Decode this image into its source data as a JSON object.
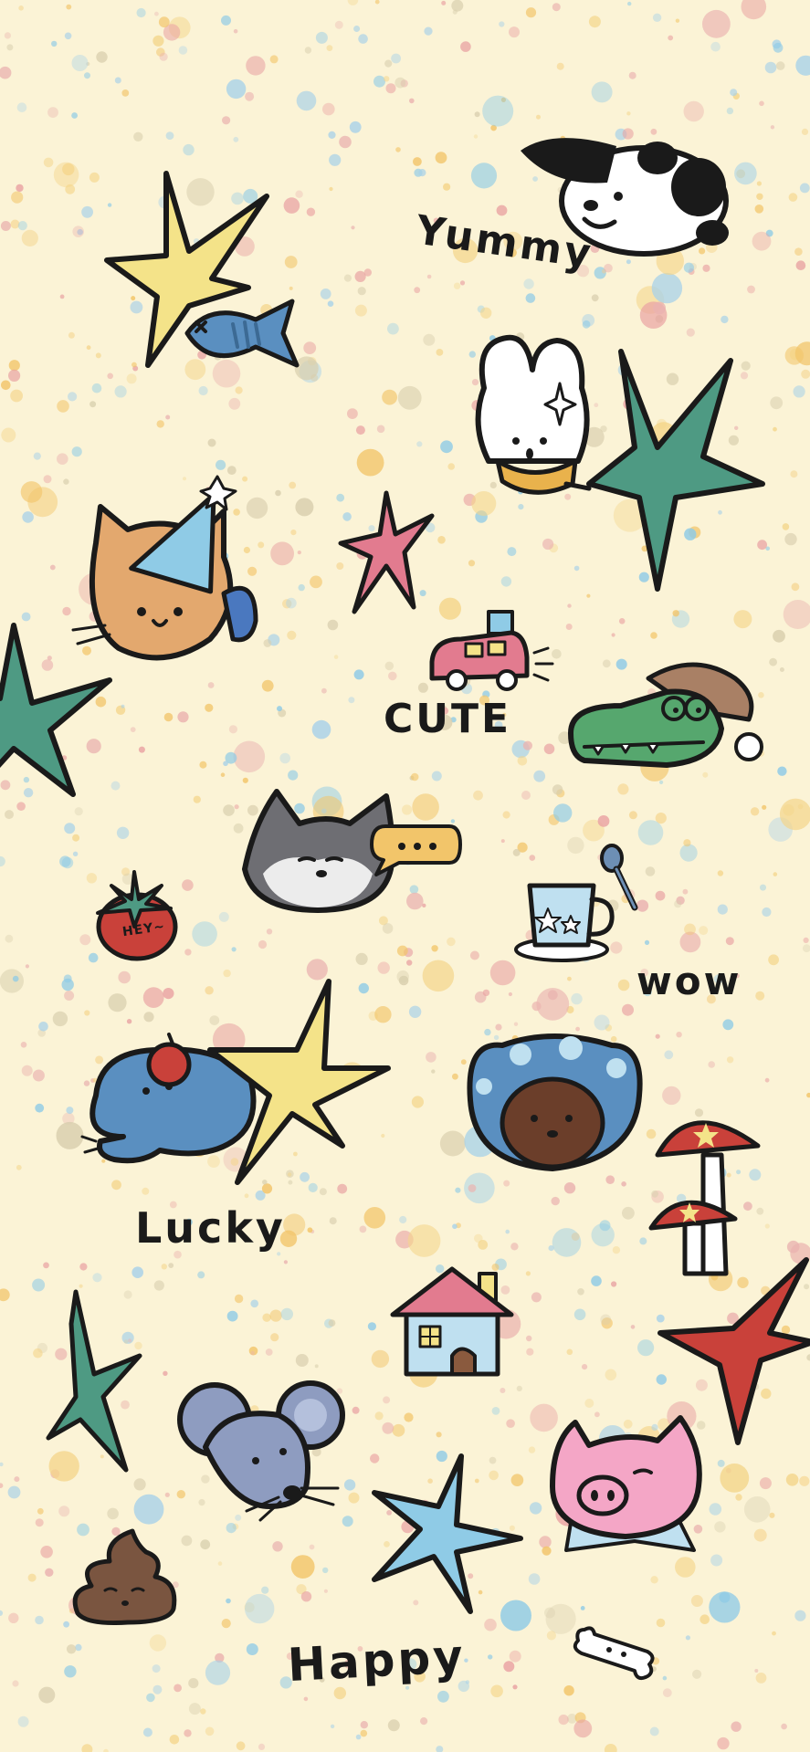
{
  "words": {
    "yummy": "Yummy",
    "cute": "CUTE",
    "wow": "wow",
    "lucky": "Lucky",
    "happy": "Happy",
    "tomato_label": "HEY~"
  },
  "stickers": [
    "yellow-star-icon",
    "fish-icon",
    "dog-icon",
    "bunny-icon",
    "green-star-icon",
    "pink-star-icon",
    "cat-party-hat-icon",
    "green-star-left-icon",
    "car-icon",
    "crocodile-icon",
    "husky-icon",
    "speech-bubble-icon",
    "tomato-icon",
    "cup-icon",
    "spoon-icon",
    "elephant-icon",
    "apple-icon",
    "yellow-star-large-icon",
    "bear-hood-icon",
    "mushroom-icon",
    "house-icon",
    "red-star-icon",
    "green-star-small-icon",
    "mouse-icon",
    "blue-star-icon",
    "pig-icon",
    "poop-icon",
    "bone-icon"
  ],
  "colors": {
    "background": "#fbf3d6",
    "outline": "#1a1a1a",
    "yellow": "#f4e389",
    "teal": "#4e9a83",
    "pink": "#e27b8f",
    "blue": "#5a8fc0",
    "red": "#c9413a",
    "lightblue": "#8fcbe6"
  }
}
